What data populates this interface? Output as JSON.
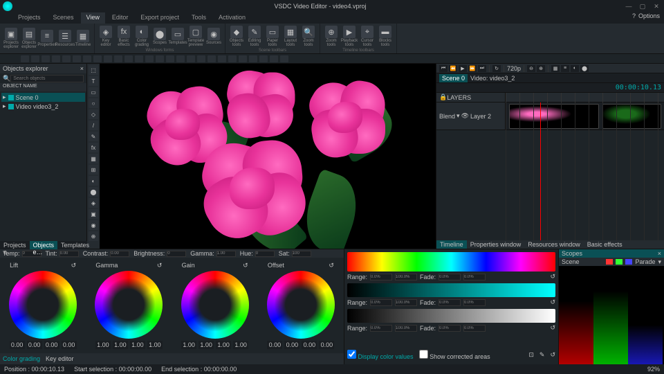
{
  "titlebar": {
    "app": "VSDC Video Editor",
    "file": "video4.vproj"
  },
  "menu": [
    "Projects",
    "Scenes",
    "View",
    "Editor",
    "Export project",
    "Tools",
    "Activation"
  ],
  "menu_active": 2,
  "titlebar_right": {
    "help": "?",
    "options": "Options"
  },
  "ribbon": {
    "groups": [
      {
        "label": "",
        "items": [
          {
            "lbl": "Projects explorer",
            "ic": "▣"
          },
          {
            "lbl": "Objects explorer",
            "ic": "▤"
          },
          {
            "lbl": "Properties",
            "ic": "≡"
          },
          {
            "lbl": "Resources",
            "ic": "☰"
          },
          {
            "lbl": "Timeline",
            "ic": "▦"
          }
        ]
      },
      {
        "label": "Windows forms",
        "items": [
          {
            "lbl": "Key editor",
            "ic": "◈"
          },
          {
            "lbl": "Basic effects",
            "ic": "fx"
          },
          {
            "lbl": "Color grading",
            "ic": "◐"
          },
          {
            "lbl": "Scopes",
            "ic": "⬤"
          },
          {
            "lbl": "Templates",
            "ic": "▭"
          },
          {
            "lbl": "Template preview",
            "ic": "▢"
          },
          {
            "lbl": "Sources",
            "ic": "◉"
          }
        ]
      },
      {
        "label": "Scene toolbars",
        "items": [
          {
            "lbl": "Objects tools",
            "ic": "◆"
          },
          {
            "lbl": "Editing tools",
            "ic": "✎"
          },
          {
            "lbl": "Paper tools",
            "ic": "▭"
          },
          {
            "lbl": "Layout tools",
            "ic": "▦"
          },
          {
            "lbl": "Zoom tools",
            "ic": "🔍"
          }
        ]
      },
      {
        "label": "Timeline toolbars",
        "items": [
          {
            "lbl": "Zoom tools",
            "ic": "⊕"
          },
          {
            "lbl": "Playback tools",
            "ic": "▶"
          },
          {
            "lbl": "Cursor tools",
            "ic": "⌖"
          },
          {
            "lbl": "Blocks tools",
            "ic": "▬"
          }
        ]
      }
    ]
  },
  "objects_explorer": {
    "title": "Objects explorer",
    "oname": "OBJECT NAME",
    "search_ph": "Search objects",
    "tree": [
      {
        "label": "Scene 0",
        "sel": true
      },
      {
        "label": "Video video3_2",
        "sel": false
      }
    ]
  },
  "timeline": {
    "scene_tab": "Scene 0",
    "video_tab": "Video: video3_2",
    "timecode": "00:00:10.13",
    "fps_label": "720p",
    "track": {
      "blend": "Blend",
      "layer": "Layer 2"
    }
  },
  "right_tabs": [
    "Timeline",
    "Properties window",
    "Resources window",
    "Basic effects"
  ],
  "bottom_tabs": [
    "Projects e…",
    "Objects e…",
    "Templates"
  ],
  "color_grading": {
    "top_params": [
      {
        "n": "Temp",
        "v": "0"
      },
      {
        "n": "Tint",
        "v": "0.00"
      },
      {
        "n": "Contrast",
        "v": "0.00"
      },
      {
        "n": "Brightness",
        "v": "0"
      },
      {
        "n": "Gamma",
        "v": "1.00"
      },
      {
        "n": "Hue",
        "v": "0"
      },
      {
        "n": "Sat",
        "v": "100"
      }
    ],
    "wheels": [
      {
        "name": "Lift",
        "vals": [
          "0.00",
          "0.00",
          "0.00",
          "0.00"
        ]
      },
      {
        "name": "Gamma",
        "vals": [
          "1.00",
          "1.00",
          "1.00",
          "1.00"
        ]
      },
      {
        "name": "Gain",
        "vals": [
          "1.00",
          "1.00",
          "1.00",
          "1.00"
        ]
      },
      {
        "name": "Offset",
        "vals": [
          "0.00",
          "0.00",
          "0.00",
          "0.00"
        ]
      }
    ],
    "bot_tabs": [
      "Color grading",
      "Key editor"
    ]
  },
  "ramps": [
    {
      "cls": "hue",
      "range1": "0.0%",
      "range2": "100.0%",
      "fade1": "0.0%",
      "fade2": "0.0%"
    },
    {
      "cls": "sat",
      "range1": "0.0%",
      "range2": "100.0%",
      "fade1": "0.0%",
      "fade2": "0.0%"
    },
    {
      "cls": "lum",
      "range1": "0.0%",
      "range2": "100.0%",
      "fade1": "0.0%",
      "fade2": "0.0%"
    }
  ],
  "ramp_labels": {
    "range": "Range:",
    "fade": "Fade:"
  },
  "ramp_checks": {
    "c1": "Display color values",
    "c2": "Show corrected areas"
  },
  "scopes": {
    "title": "Scopes",
    "scene": "Scene",
    "parade": "Parade",
    "colors": [
      "#f33",
      "#3f3",
      "#44f"
    ]
  },
  "status": {
    "pos": "Position : 00:00:10.13",
    "start": "Start selection : 00:00:00.00",
    "end": "End selection : 00:00:00.00",
    "pct": "92%"
  }
}
